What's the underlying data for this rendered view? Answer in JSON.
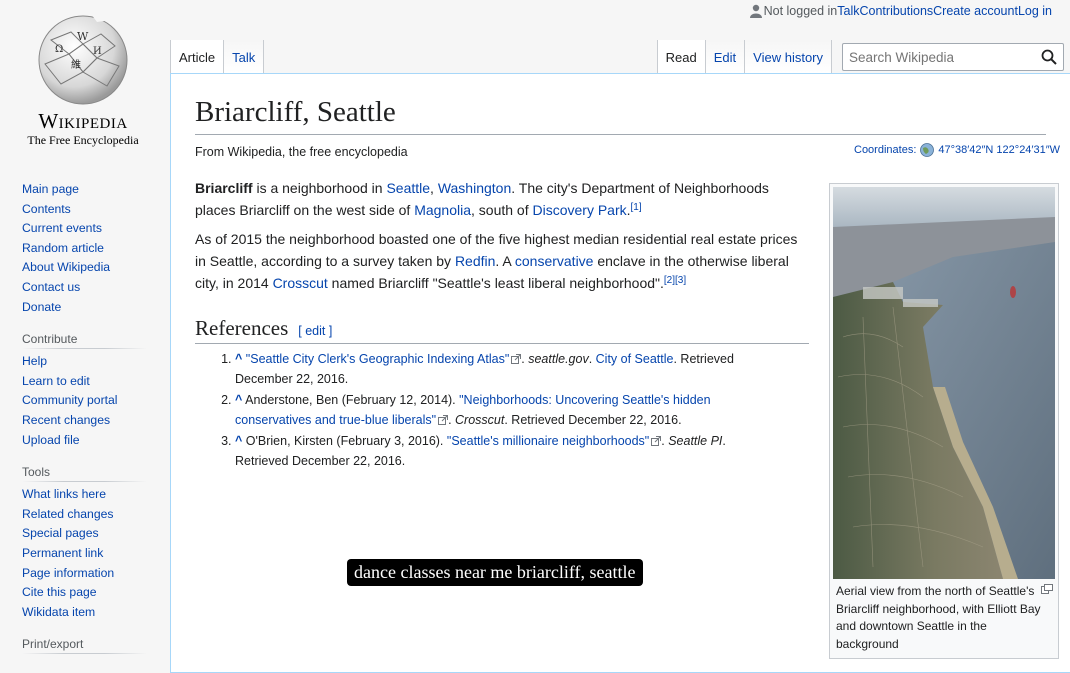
{
  "personal": {
    "not_logged": "Not logged in",
    "talk": "Talk",
    "contributions": "Contributions",
    "create_account": "Create account",
    "login": "Log in"
  },
  "logo": {
    "wordmark": "Wikipedia",
    "tagline": "The Free Encyclopedia"
  },
  "sidebar": {
    "navigation": [
      "Main page",
      "Contents",
      "Current events",
      "Random article",
      "About Wikipedia",
      "Contact us",
      "Donate"
    ],
    "contribute_heading": "Contribute",
    "contribute": [
      "Help",
      "Learn to edit",
      "Community portal",
      "Recent changes",
      "Upload file"
    ],
    "tools_heading": "Tools",
    "tools": [
      "What links here",
      "Related changes",
      "Special pages",
      "Permanent link",
      "Page information",
      "Cite this page",
      "Wikidata item"
    ],
    "print_heading": "Print/export"
  },
  "tabs": {
    "article": "Article",
    "talk": "Talk",
    "read": "Read",
    "edit": "Edit",
    "history": "View history",
    "search_placeholder": "Search Wikipedia"
  },
  "article": {
    "title": "Briarcliff, Seattle",
    "site_sub": "From Wikipedia, the free encyclopedia",
    "coords_label": "Coordinates:",
    "coords_value": "47°38′42″N 122°24′31″W",
    "p1": {
      "bold": "Briarcliff",
      "t1": " is a neighborhood in ",
      "l1": "Seattle",
      "t2": ", ",
      "l2": "Washington",
      "t3": ". The city's Department of Neighborhoods places Briarcliff on the west side of ",
      "l3": "Magnolia",
      "t4": ", south of ",
      "l4": "Discovery Park",
      "t5": ".",
      "ref": "[1]"
    },
    "p2": {
      "t1": "As of 2015 the neighborhood boasted one of the five highest median residential real estate prices in Seattle, according to a survey taken by ",
      "l1": "Redfin",
      "t2": ". A ",
      "l2": "conservative",
      "t3": " enclave in the otherwise liberal city, in 2014 ",
      "l3": "Crosscut",
      "t4": " named Briarcliff \"Seattle's least liberal neighborhood\".",
      "ref": "[2][3]"
    },
    "references_heading": "References",
    "edit_section": "[ edit ]",
    "refs": [
      {
        "caret": "^",
        "pre": "",
        "title": "\"Seattle City Clerk's Geographic Indexing Atlas\"",
        "work": "seattle.gov",
        "sep": ". ",
        "publisher": "City of Seattle",
        "post": ". Retrieved December 22, 2016."
      },
      {
        "caret": "^",
        "pre": "Anderstone, Ben (February 12, 2014). ",
        "title": "\"Neighborhoods: Uncovering Seattle's hidden conservatives and true-blue liberals\"",
        "work": "Crosscut",
        "sep": "",
        "publisher": "",
        "post": ". Retrieved December 22, 2016."
      },
      {
        "caret": "^",
        "pre": "O'Brien, Kirsten (February 3, 2016). ",
        "title": "\"Seattle's millionaire neighborhoods\"",
        "work": "Seattle PI",
        "sep": "",
        "publisher": "",
        "post": ". Retrieved December 22, 2016."
      }
    ]
  },
  "thumb": {
    "caption": "Aerial view from the north of Seattle's Briarcliff neighborhood, with Elliott Bay and downtown Seattle in the background"
  },
  "overlay": {
    "text": "dance classes near me briarcliff, seattle"
  },
  "icons": [
    "user-icon",
    "search-icon",
    "globe-icon",
    "external-link-icon",
    "magnify-icon"
  ],
  "colors": {
    "link": "#0645ad",
    "text": "#202122",
    "border": "#a7d7f9"
  }
}
